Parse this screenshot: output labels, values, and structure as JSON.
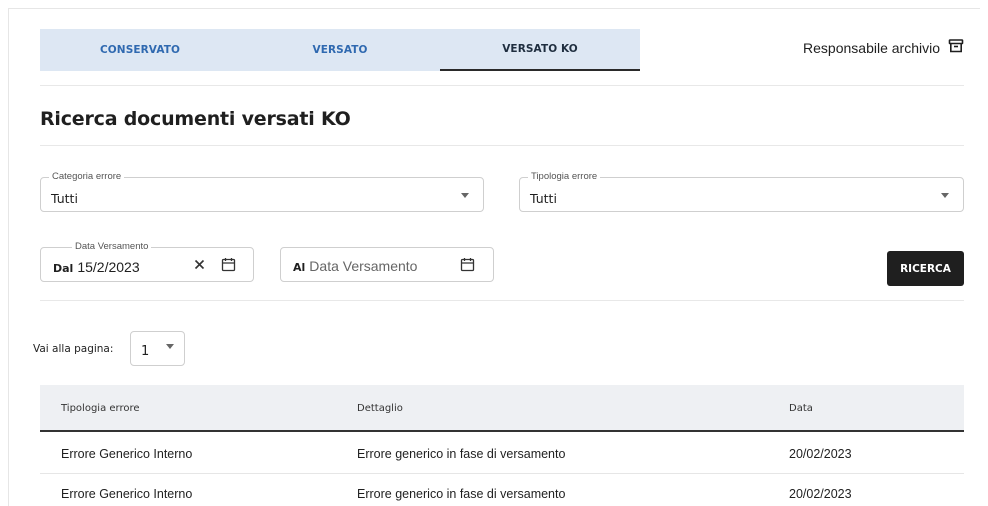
{
  "tabs": [
    {
      "label": "CONSERVATO",
      "active": false
    },
    {
      "label": "VERSATO",
      "active": false
    },
    {
      "label": "VERSATO KO",
      "active": true
    }
  ],
  "header": {
    "responsabile_label": "Responsabile archivio",
    "icon": "archive-icon"
  },
  "page": {
    "title": "Ricerca documenti versati KO"
  },
  "filters": {
    "categoria": {
      "label": "Categoria errore",
      "value": "Tutti"
    },
    "tipologia": {
      "label": "Tipologia errore",
      "value": "Tutti"
    },
    "data_dal": {
      "label": "Data Versamento",
      "prefix": "Dal",
      "value": "15/2/2023"
    },
    "data_al": {
      "prefix": "Al",
      "placeholder": "Data Versamento"
    },
    "search_label": "RICERCA"
  },
  "pagination": {
    "label": "Vai alla pagina:",
    "value": "1"
  },
  "table": {
    "columns": [
      "Tipologia errore",
      "Dettaglio",
      "Data"
    ],
    "rows": [
      [
        "Errore Generico Interno",
        "Errore generico in fase di versamento",
        "20/02/2023"
      ],
      [
        "Errore Generico Interno",
        "Errore generico in fase di versamento",
        "20/02/2023"
      ]
    ]
  },
  "colors": {
    "tab_bg": "#dde7f3",
    "tab_text": "#2f69b0",
    "button_bg": "#1f1f1f"
  }
}
